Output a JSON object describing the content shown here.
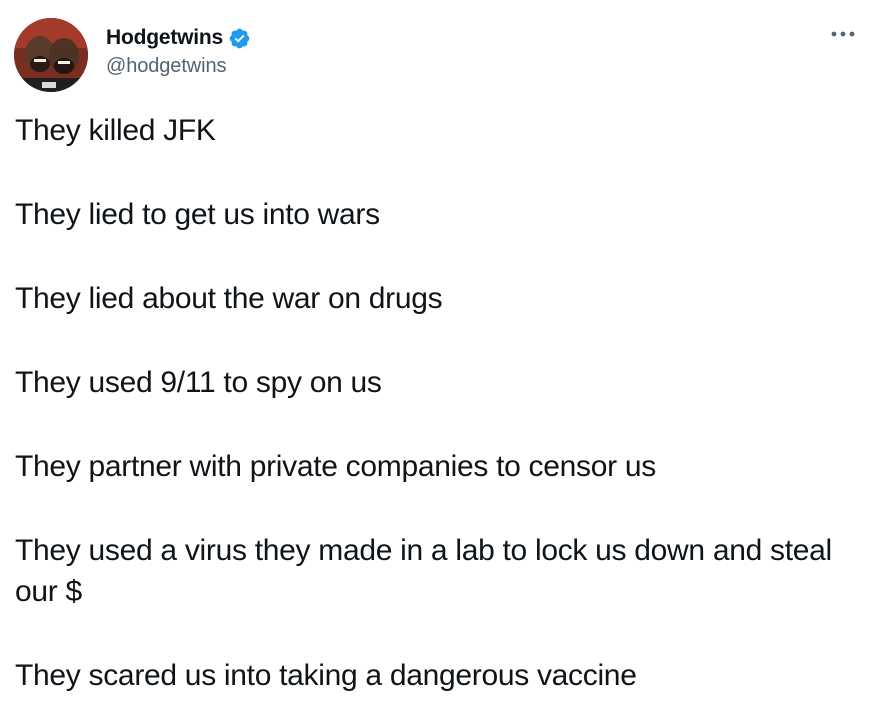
{
  "tweet": {
    "author": {
      "display_name": "Hodgetwins",
      "handle": "@hodgetwins",
      "verified": true,
      "avatar_icon": "profile-photo"
    },
    "more_icon": "more-options-icon",
    "lines": [
      "They killed JFK",
      "They lied to get us into wars",
      "They lied about the war on drugs",
      "They used 9/11 to spy on us",
      "They partner with private companies to censor us",
      "They used a virus they made in a lab to lock us down and steal our $",
      "They scared us into taking a dangerous vaccine"
    ],
    "colors": {
      "text": "#0f1419",
      "secondary": "#536471",
      "verified_badge": "#1d9bf0"
    }
  }
}
